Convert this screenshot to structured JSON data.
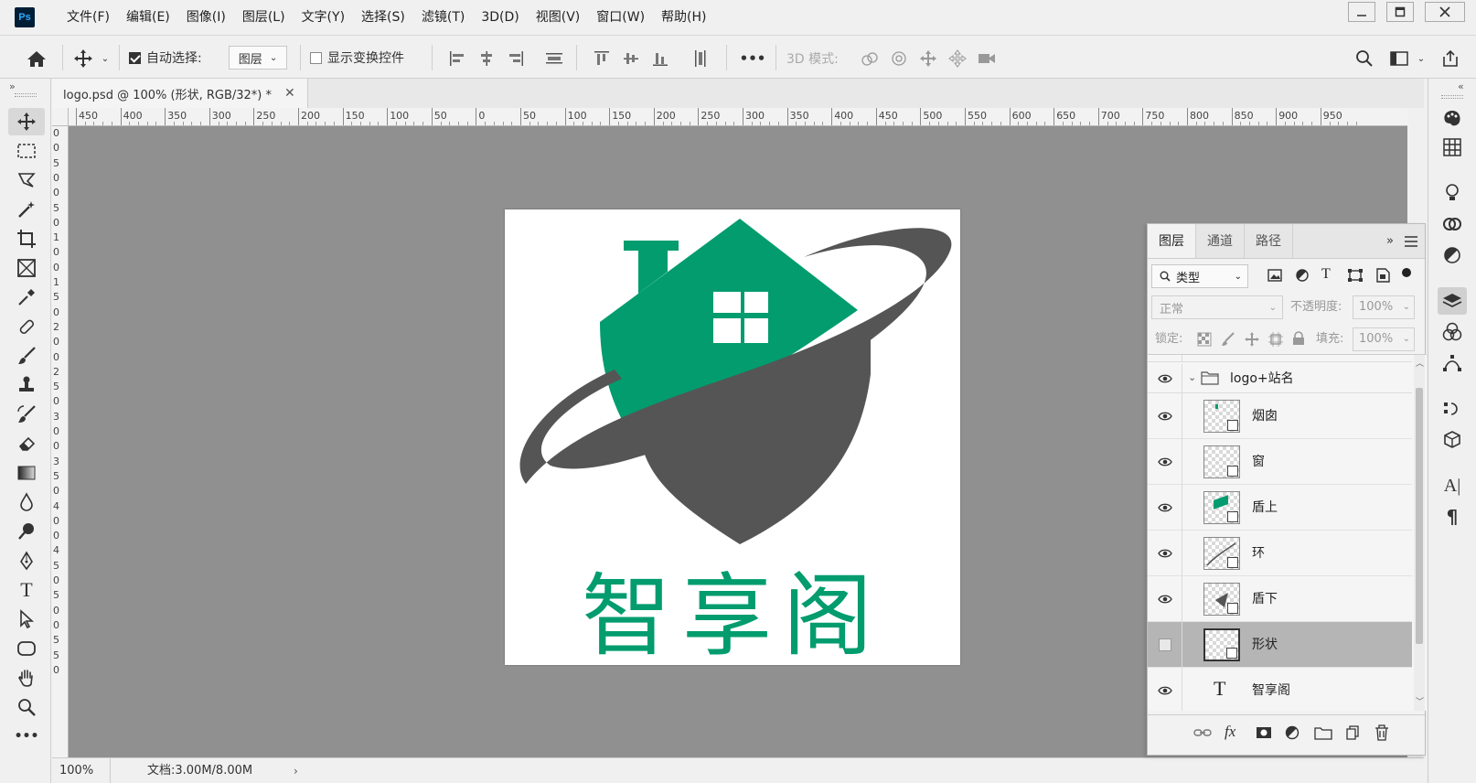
{
  "app": {
    "logo_text": "Ps"
  },
  "menus": [
    "文件(F)",
    "编辑(E)",
    "图像(I)",
    "图层(L)",
    "文字(Y)",
    "选择(S)",
    "滤镜(T)",
    "3D(D)",
    "视图(V)",
    "窗口(W)",
    "帮助(H)"
  ],
  "options": {
    "auto_select_label": "自动选择:",
    "auto_select_value": "图层",
    "show_transform_label": "显示变换控件",
    "more_label": "•••",
    "mode_3d_label": "3D 模式:"
  },
  "document": {
    "tab_title": "logo.psd @ 100% (形状, RGB/32*) *",
    "zoom": "100%",
    "doc_info": "文档:3.00M/8.00M",
    "ruler_h_labels": [
      "450",
      "400",
      "350",
      "300",
      "250",
      "200",
      "150",
      "100",
      "50",
      "0",
      "50",
      "100",
      "150",
      "200",
      "250",
      "300",
      "350",
      "400",
      "450",
      "500",
      "550",
      "600",
      "650",
      "700",
      "750",
      "800",
      "850",
      "900",
      "950"
    ],
    "ruler_v_labels": [
      "0",
      "0",
      "5",
      "0",
      "0",
      "5",
      "0",
      "1",
      "0",
      "0",
      "1",
      "5",
      "0",
      "2",
      "0",
      "0",
      "2",
      "5",
      "0",
      "3",
      "0",
      "0",
      "3",
      "5",
      "0",
      "4",
      "0",
      "0",
      "4",
      "5",
      "0",
      "5",
      "0",
      "0",
      "5",
      "5",
      "0"
    ],
    "logo_text": "智享阁",
    "colors": {
      "green": "#029c6e",
      "gray": "#555555",
      "canvas": "#909090"
    }
  },
  "layers_panel": {
    "tabs": [
      "图层",
      "通道",
      "路径"
    ],
    "filter_label": "类型",
    "blend_mode": "正常",
    "opacity_label": "不透明度:",
    "opacity_value": "100%",
    "lock_label": "锁定:",
    "fill_label": "填充:",
    "fill_value": "100%",
    "group_name": "logo+站名",
    "layers": [
      {
        "name": "烟囱",
        "visible": true,
        "selected": false
      },
      {
        "name": "窗",
        "visible": true,
        "selected": false
      },
      {
        "name": "盾上",
        "visible": true,
        "selected": false
      },
      {
        "name": "环",
        "visible": true,
        "selected": false
      },
      {
        "name": "盾下",
        "visible": true,
        "selected": false
      },
      {
        "name": "形状",
        "visible": false,
        "selected": true
      },
      {
        "name": "智享阁",
        "visible": true,
        "selected": false
      }
    ]
  }
}
